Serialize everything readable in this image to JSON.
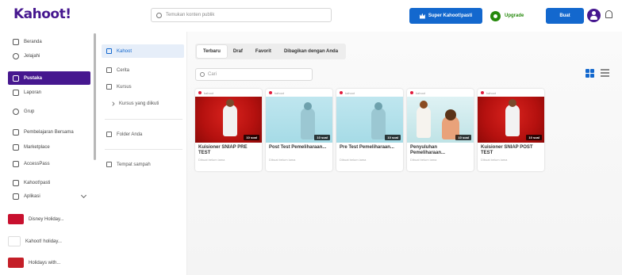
{
  "header": {
    "logo": "Kahoot!",
    "search_placeholder": "Temukan konten publik",
    "kahoot_plus_label": "Super Kahoot!pasti",
    "upgrade_label": "Upgrade",
    "create_label": "Buat"
  },
  "sidebar": {
    "items": [
      {
        "label": "Beranda"
      },
      {
        "label": "Jelajahi"
      },
      {
        "label": "Pustaka"
      },
      {
        "label": "Laporan"
      },
      {
        "label": "Grup"
      },
      {
        "label": "Pembelajaran Bersama"
      },
      {
        "label": "Marketplace"
      },
      {
        "label": "AccessPass"
      },
      {
        "label": "Kahoot!pasti"
      },
      {
        "label": "Aplikasi"
      }
    ],
    "promos": [
      {
        "label": "Disney Holiday..."
      },
      {
        "label": "Kahoot! holiday..."
      },
      {
        "label": "Holidays with..."
      }
    ]
  },
  "folders": {
    "items": [
      {
        "label": "Kahoot"
      },
      {
        "label": "Cerita"
      },
      {
        "label": "Kursus"
      },
      {
        "label": "Kursus yang diikuti"
      },
      {
        "label": "Folder Anda"
      },
      {
        "label": "Tempat sampah"
      }
    ]
  },
  "main": {
    "tabs": [
      {
        "label": "Terbaru"
      },
      {
        "label": "Draf"
      },
      {
        "label": "Favorit"
      },
      {
        "label": "Dibagikan dengan Anda"
      }
    ],
    "search_placeholder": "Cari",
    "cards": [
      {
        "owner": "kahoot",
        "title": "Kuisioner SNIAP PRE TEST",
        "questions": "10 soal",
        "meta": "Dibuat belum lama"
      },
      {
        "owner": "kahoot",
        "title": "Post Test Pemeliharaan...",
        "questions": "10 soal",
        "meta": "Dibuat belum lama"
      },
      {
        "owner": "kahoot",
        "title": "Pre Test Pemeliharaan...",
        "questions": "10 soal",
        "meta": "Dibuat belum lama"
      },
      {
        "owner": "kahoot",
        "title": "Penyuluhan Pemeliharaan...",
        "questions": "10 soal",
        "meta": "Dibuat belum lama"
      },
      {
        "owner": "kahoot",
        "title": "Kuisioner SNIAP POST TEST",
        "questions": "10 soal",
        "meta": "Dibuat belum lama"
      }
    ]
  },
  "colors": {
    "brand": "#46178f",
    "primary": "#1368ce",
    "upgrade": "#26890c"
  }
}
